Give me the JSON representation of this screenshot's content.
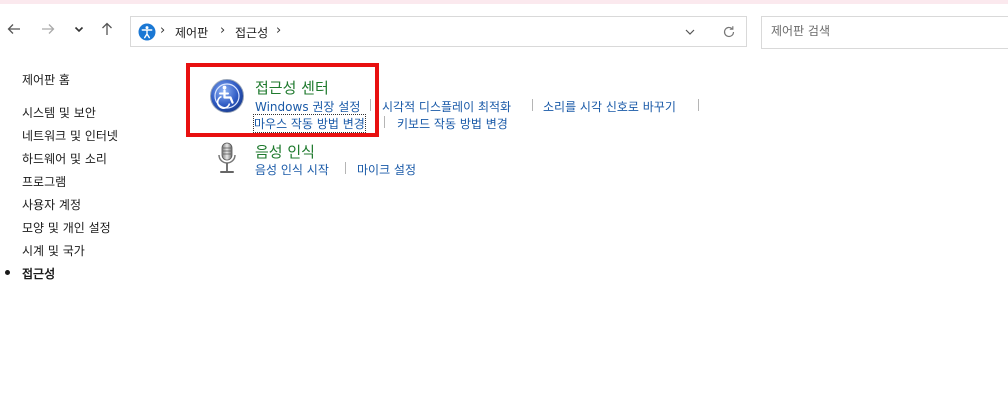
{
  "breadcrumb": {
    "items": [
      "제어판",
      "접근성"
    ]
  },
  "search": {
    "placeholder": "제어판 검색"
  },
  "sidebar": {
    "items": [
      {
        "label": "제어판 홈"
      },
      {
        "label": "시스템 및 보안"
      },
      {
        "label": "네트워크 및 인터넷"
      },
      {
        "label": "하드웨어 및 소리"
      },
      {
        "label": "프로그램"
      },
      {
        "label": "사용자 계정"
      },
      {
        "label": "모양 및 개인 설정"
      },
      {
        "label": "시계 및 국가"
      },
      {
        "label": "접근성",
        "current": true
      }
    ]
  },
  "categories": {
    "ease_center": {
      "title": "접근성 센터",
      "icon": "ease-of-access-center-icon",
      "links": [
        "Windows 권장 설정",
        "시각적 디스플레이 최적화",
        "소리를 시각 신호로 바꾸기",
        "마우스 작동 방법 변경",
        "키보드 작동 방법 변경"
      ]
    },
    "speech": {
      "title": "음성 인식",
      "icon": "microphone-icon",
      "links": [
        "음성 인식 시작",
        "마이크 설정"
      ]
    }
  },
  "colors": {
    "category_title": "#1f7a2e",
    "link": "#1a5aa8",
    "highlight_box": "#e81010"
  }
}
